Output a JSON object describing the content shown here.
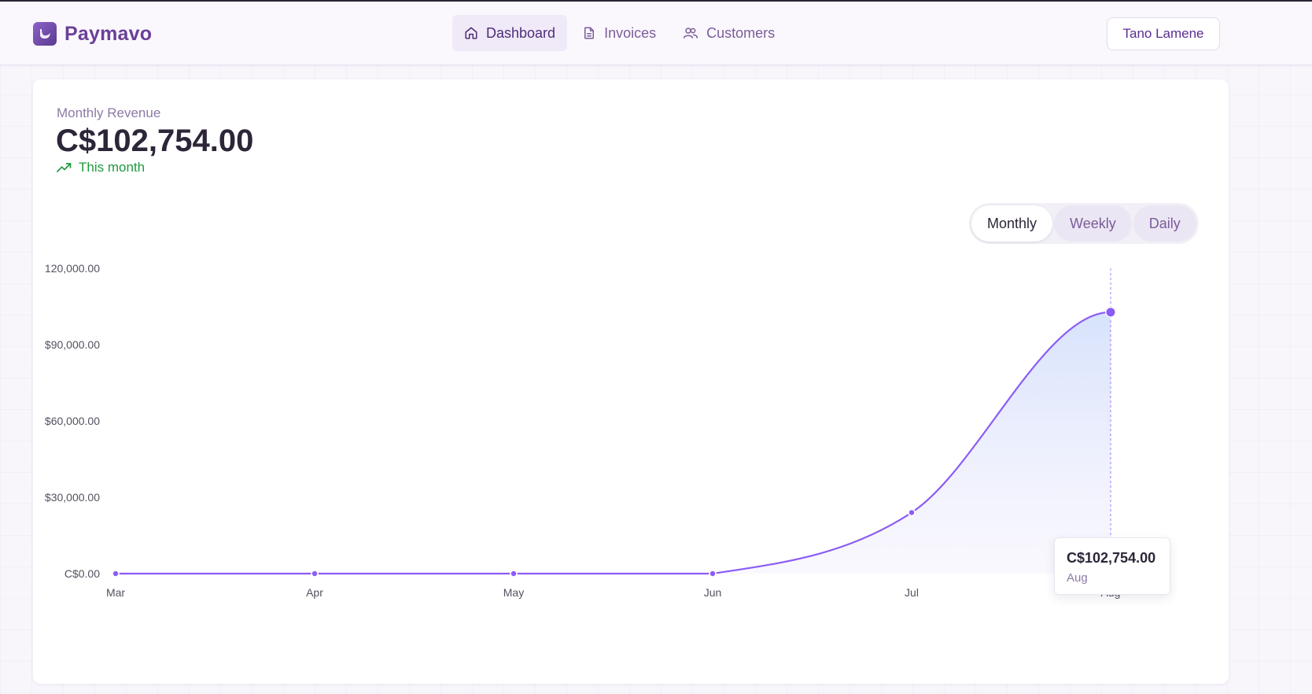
{
  "app": {
    "name": "Paymavo"
  },
  "nav": {
    "items": [
      {
        "label": "Dashboard",
        "icon": "home-icon",
        "active": true
      },
      {
        "label": "Invoices",
        "icon": "document-icon",
        "active": false
      },
      {
        "label": "Customers",
        "icon": "users-icon",
        "active": false
      }
    ]
  },
  "user": {
    "name": "Tano Lamene"
  },
  "revenue": {
    "label": "Monthly Revenue",
    "value": "C$102,754.00",
    "trend_text": "This month",
    "trend_icon": "trending-up-icon"
  },
  "range_tabs": [
    {
      "label": "Monthly",
      "active": true
    },
    {
      "label": "Weekly",
      "active": false
    },
    {
      "label": "Daily",
      "active": false
    }
  ],
  "tooltip": {
    "value": "C$102,754.00",
    "label": "Aug"
  },
  "colors": {
    "accent": "#8b5cf6",
    "brand": "#6b3f99",
    "trend_up": "#1f9a3e"
  },
  "chart_data": {
    "type": "area",
    "categories": [
      "Mar",
      "Apr",
      "May",
      "Jun",
      "Jul",
      "Aug"
    ],
    "values": [
      0,
      0,
      0,
      0,
      24000,
      102754
    ],
    "ylim": [
      0,
      120000
    ],
    "yticks": [
      {
        "value": 0,
        "label": "C$0.00"
      },
      {
        "value": 30000,
        "label": "$30,000.00"
      },
      {
        "value": 60000,
        "label": "$60,000.00"
      },
      {
        "value": 90000,
        "label": "$90,000.00"
      },
      {
        "value": 120000,
        "label": "120,000.00"
      }
    ],
    "highlight_index": 5,
    "grid": false,
    "legend": "none"
  }
}
